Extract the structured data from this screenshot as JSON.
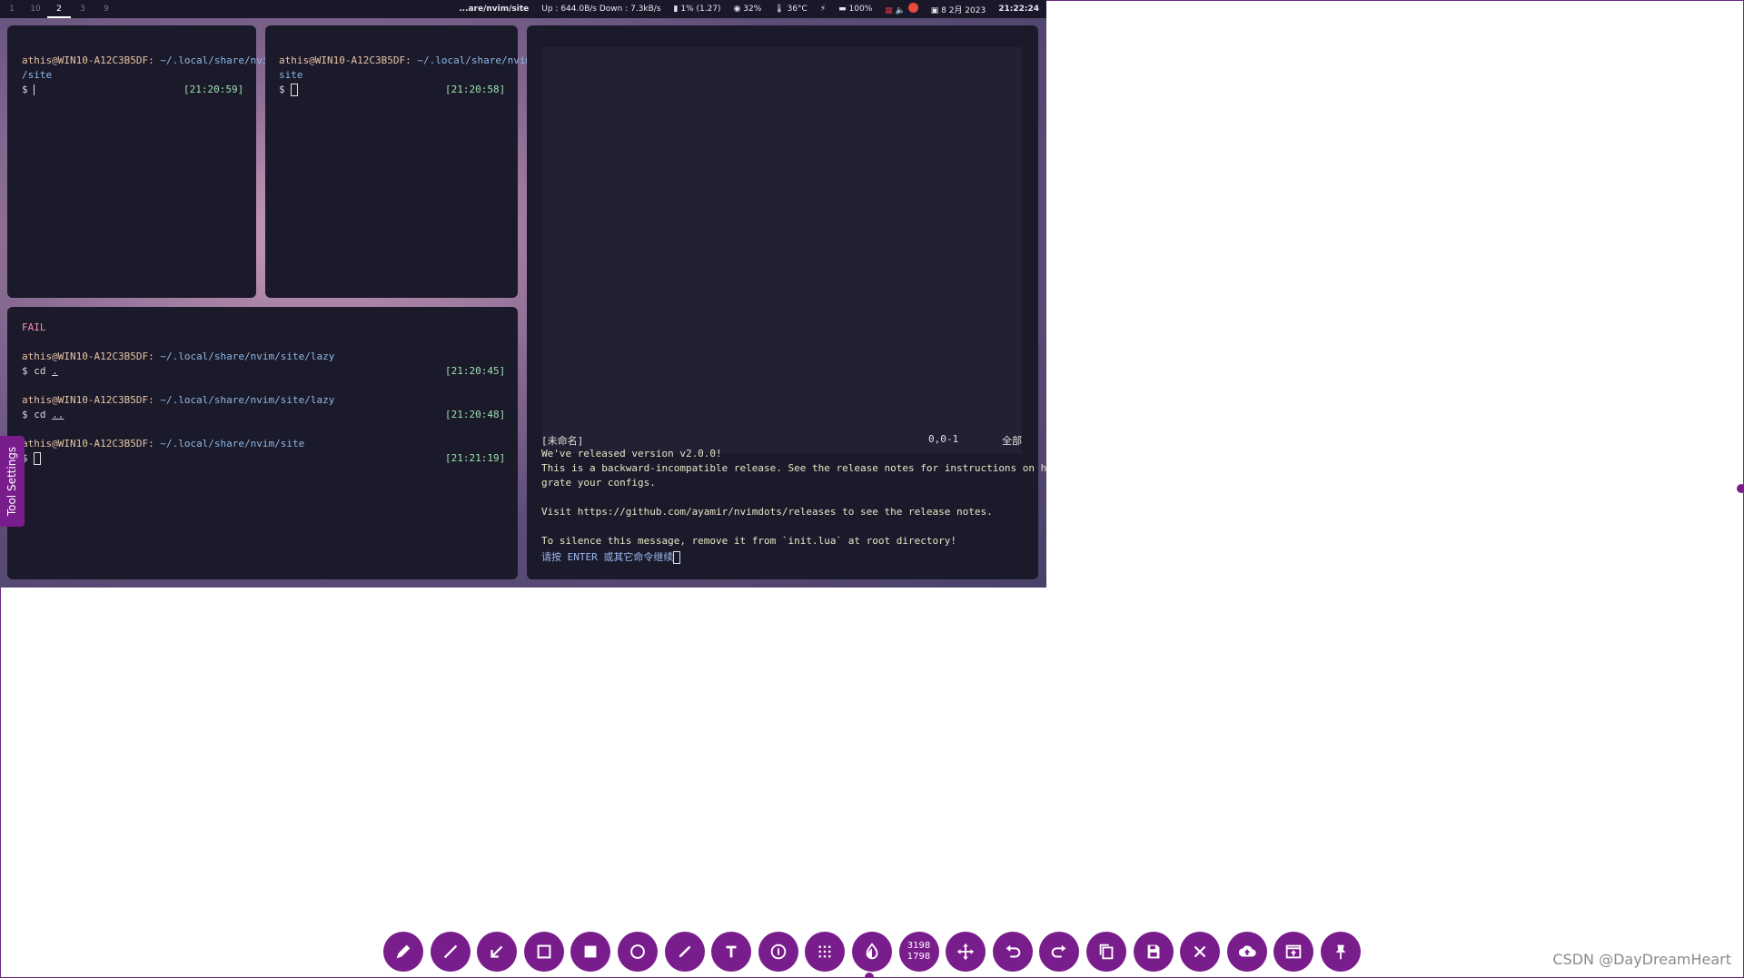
{
  "topbar": {
    "workspaces": [
      "1",
      "10",
      "2",
      "3",
      "9"
    ],
    "active_workspace": "2",
    "path": "...are/nvim/site",
    "network": "Up : 644.0B/s Down : 7.3kB/s",
    "cpu": "1% (1.27)",
    "mem": "32%",
    "temp": "36°C",
    "battery": "100%",
    "date": "8 2月 2023",
    "time": "21:22:24"
  },
  "pane1": {
    "user": "athis@WIN10-A12C3B5DF:",
    "path1": "~/.local/share/nvim",
    "path2": "/site",
    "prompt": "$",
    "timestamp": "[21:20:59]"
  },
  "pane2": {
    "user": "athis@WIN10-A12C3B5DF:",
    "path1": "~/.local/share/nvim/",
    "path2": "site",
    "prompt": "$",
    "timestamp": "[21:20:58]"
  },
  "pane3": {
    "fail": "FAIL",
    "entries": [
      {
        "user": "athis@WIN10-A12C3B5DF:",
        "path": "~/.local/share/nvim/site/lazy",
        "cmd": "$ cd ",
        "arg": ".",
        "timestamp": "[21:20:45]"
      },
      {
        "user": "athis@WIN10-A12C3B5DF:",
        "path": "~/.local/share/nvim/site/lazy",
        "cmd": "$ cd ",
        "arg": "..",
        "timestamp": "[21:20:48]"
      },
      {
        "user": "athis@WIN10-A12C3B5DF:",
        "path": "~/.local/share/nvim/site",
        "cmd": "$",
        "arg": "",
        "timestamp": "[21:21:19]"
      }
    ]
  },
  "nvim": {
    "statusline_name": "[未命名]",
    "statusline_pos": "0,0-1",
    "statusline_all": "全部",
    "messages": [
      "We've released version v2.0.0!",
      "This is a backward-incompatible release. See the release notes for instructions on how to mi",
      "grate your configs.",
      "",
      "Visit https://github.com/ayamir/nvimdots/releases to see the release notes.",
      "",
      "To silence this message, remove it from `init.lua` at root directory!"
    ],
    "prompt": "请按 ENTER 或其它命令继续"
  },
  "tool_settings_label": "Tool Settings",
  "toolbar": {
    "buttons": [
      {
        "name": "pencil-icon"
      },
      {
        "name": "line-icon"
      },
      {
        "name": "arrow-icon"
      },
      {
        "name": "rectangle-outline-icon"
      },
      {
        "name": "rectangle-filled-icon"
      },
      {
        "name": "circle-icon"
      },
      {
        "name": "marker-icon"
      },
      {
        "name": "text-icon"
      },
      {
        "name": "counter-icon"
      },
      {
        "name": "pixelate-icon"
      },
      {
        "name": "invert-icon"
      },
      {
        "name": "size-readout"
      },
      {
        "name": "move-icon"
      },
      {
        "name": "undo-icon"
      },
      {
        "name": "redo-icon"
      },
      {
        "name": "copy-icon"
      },
      {
        "name": "save-icon"
      },
      {
        "name": "close-icon"
      },
      {
        "name": "upload-icon"
      },
      {
        "name": "open-app-icon"
      },
      {
        "name": "pin-icon"
      }
    ],
    "size_w": "3198",
    "size_h": "1798"
  },
  "watermark": "CSDN @DayDreamHeart"
}
